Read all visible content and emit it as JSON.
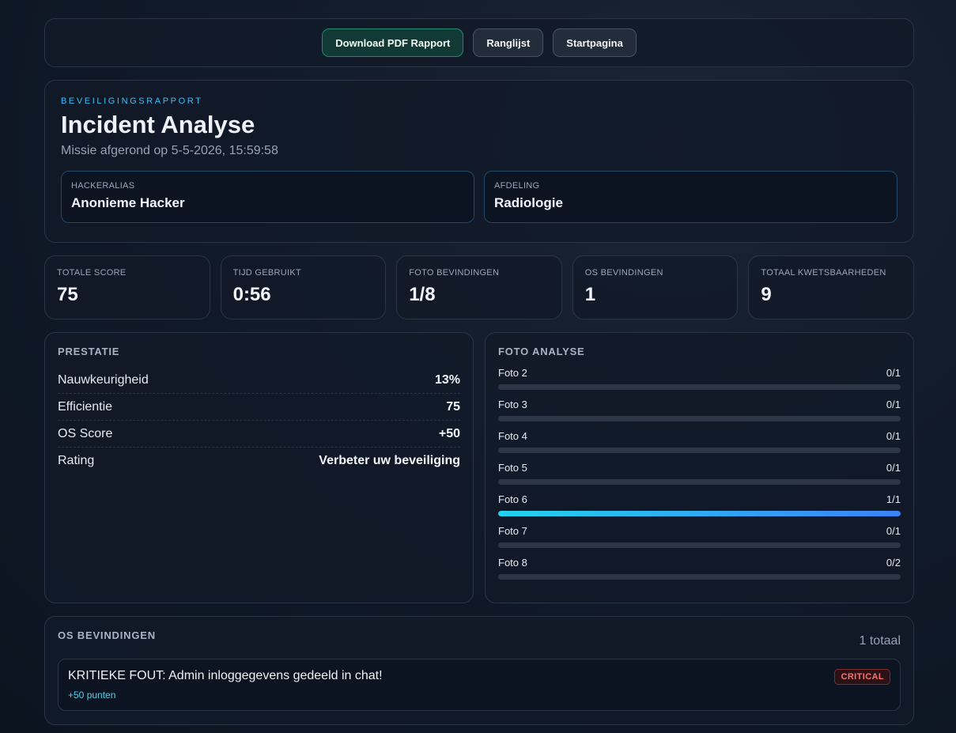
{
  "toolbar": {
    "download_label": "Download PDF Rapport",
    "leaderboard_label": "Ranglijst",
    "home_label": "Startpagina"
  },
  "header": {
    "eyebrow": "BEVEILIGINGSRAPPORT",
    "title": "Incident Analyse",
    "subtitle": "Missie afgerond op 5-5-2026, 15:59:58",
    "alias_label": "HACKERALIAS",
    "alias_value": "Anonieme Hacker",
    "dept_label": "AFDELING",
    "dept_value": "Radiologie"
  },
  "stats": [
    {
      "label": "TOTALE SCORE",
      "value": "75"
    },
    {
      "label": "TIJD GEBRUIKT",
      "value": "0:56"
    },
    {
      "label": "FOTO BEVINDINGEN",
      "value": "1/8"
    },
    {
      "label": "OS BEVINDINGEN",
      "value": "1"
    },
    {
      "label": "TOTAAL KWETSBAARHEDEN",
      "value": "9"
    }
  ],
  "performance": {
    "title": "PRESTATIE",
    "rows": [
      {
        "label": "Nauwkeurigheid",
        "value": "13%"
      },
      {
        "label": "Efficientie",
        "value": "75"
      },
      {
        "label": "OS Score",
        "value": "+50"
      },
      {
        "label": "Rating",
        "value": "Verbeter uw beveiliging"
      }
    ]
  },
  "photo_analysis": {
    "title": "FOTO ANALYSE",
    "items": [
      {
        "label": "Foto 2",
        "score": "0/1",
        "fraction": 0
      },
      {
        "label": "Foto 3",
        "score": "0/1",
        "fraction": 0
      },
      {
        "label": "Foto 4",
        "score": "0/1",
        "fraction": 0
      },
      {
        "label": "Foto 5",
        "score": "0/1",
        "fraction": 0
      },
      {
        "label": "Foto 6",
        "score": "1/1",
        "fraction": 1
      },
      {
        "label": "Foto 7",
        "score": "0/1",
        "fraction": 0
      },
      {
        "label": "Foto 8",
        "score": "0/2",
        "fraction": 0
      }
    ]
  },
  "os_findings": {
    "title": "OS BEVINDINGEN",
    "total": "1 totaal",
    "items": [
      {
        "text": "KRITIEKE FOUT: Admin inloggegevens gedeeld in chat!",
        "points": "+50 punten",
        "severity": "CRITICAL"
      }
    ]
  },
  "colors": {
    "accent": "#38bdf8",
    "primary_button": "#113a36",
    "critical": "#f87171",
    "progress_start": "#22d3ee",
    "progress_end": "#3b82f6"
  }
}
